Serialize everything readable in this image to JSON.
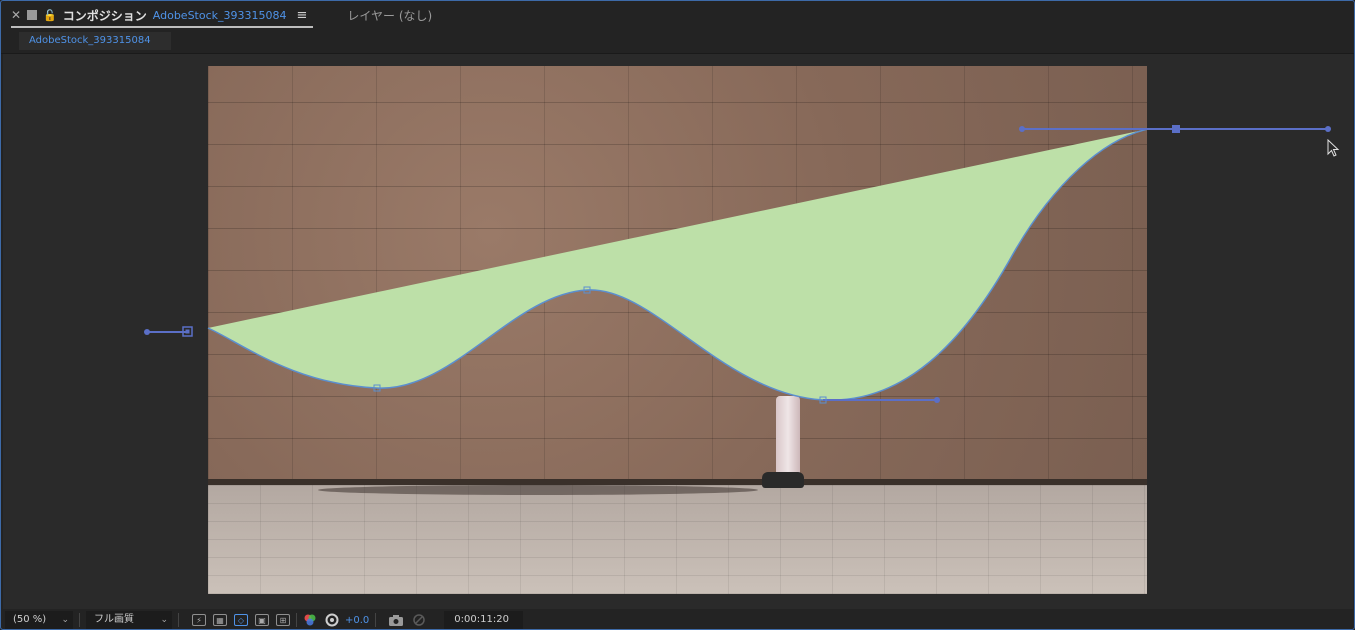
{
  "tabs": {
    "composition_title": "コンポジション",
    "composition_name": "AdobeStock_393315084",
    "layer_tab": "レイヤー (なし)"
  },
  "comp_breadcrumb": "AdobeStock_393315084",
  "icons": {
    "close": "close-icon",
    "comp": "composition-icon",
    "lock": "lock-icon",
    "menu": "hamburger-menu-icon"
  },
  "colors": {
    "accent": "#4f93e8",
    "shape_fill": "#bde0a8",
    "path": "#5b6fc7",
    "panel_border": "#3d6aa8"
  },
  "toolbar": {
    "zoom": "(50 %)",
    "quality": "フル画質",
    "exposure": "+0.0",
    "timecode": "0:00:11:20"
  }
}
